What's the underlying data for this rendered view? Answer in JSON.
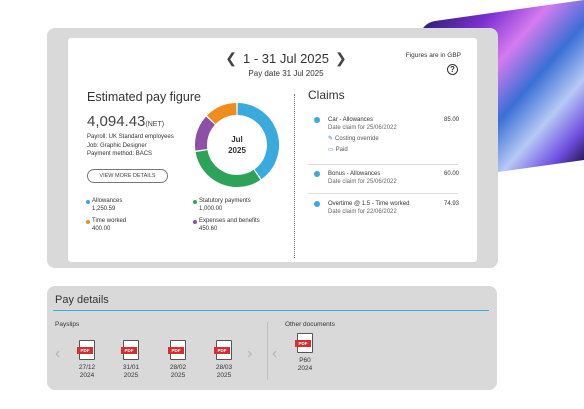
{
  "summary": {
    "period_range": "1 - 31 Jul 2025",
    "pay_date": "Pay date 31 Jul 2025",
    "figures_note": "Figures are in GBP",
    "help_glyph": "?",
    "prev_glyph": "❮",
    "next_glyph": "❯"
  },
  "estimate": {
    "title": "Estimated pay figure",
    "amount": "4,094.43",
    "amount_suffix": "(NET)",
    "payroll": "Payroll: UK Standard employees",
    "job": "Job: Graphic Designer",
    "payment_method": "Payment method: BACS",
    "more_button": "VIEW MORE DETAILS",
    "donut_label_month": "Jul",
    "donut_label_year": "2025"
  },
  "chart_data": {
    "type": "pie",
    "series": [
      {
        "name": "Allowances",
        "value": 1250.59,
        "color": "#3aa9dc"
      },
      {
        "name": "Statutory payments",
        "value": 1000.0,
        "color": "#2da35a"
      },
      {
        "name": "Expenses and benefits",
        "value": 450.6,
        "color": "#8e4fa6"
      },
      {
        "name": "Time worked",
        "value": 400.0,
        "color": "#f08c1e"
      }
    ]
  },
  "legend": [
    {
      "label": "Allowances",
      "value": "1,250.59",
      "color": "#3aa9dc"
    },
    {
      "label": "Statutory payments",
      "value": "1,000.00",
      "color": "#2da35a"
    },
    {
      "label": "Time worked",
      "value": "400.00",
      "color": "#f08c1e"
    },
    {
      "label": "Expenses and benefits",
      "value": "450.60",
      "color": "#8e4fa6"
    }
  ],
  "claims": {
    "title": "Claims",
    "items": [
      {
        "name": "Car - Allowances",
        "date": "Date claim for 25/06/2022",
        "amount": "85.00",
        "action": "Costing override",
        "status": "Paid"
      },
      {
        "name": "Bonus - Allowances",
        "date": "Date claim for 25/06/2022",
        "amount": "60.00"
      },
      {
        "name": "Overtime @ 1.5 - Time worked",
        "date": "Date claim for 22/06/2022",
        "amount": "74.93"
      }
    ]
  },
  "pay_details": {
    "title": "Pay details",
    "payslips_label": "Payslips",
    "other_label": "Other documents",
    "pdf_tag": "PDF",
    "payslips": [
      {
        "day": "27/12",
        "year": "2024"
      },
      {
        "day": "31/01",
        "year": "2025"
      },
      {
        "day": "28/02",
        "year": "2025"
      },
      {
        "day": "28/03",
        "year": "2025"
      }
    ],
    "other_docs": [
      {
        "name": "P60",
        "year": "2024"
      }
    ]
  }
}
